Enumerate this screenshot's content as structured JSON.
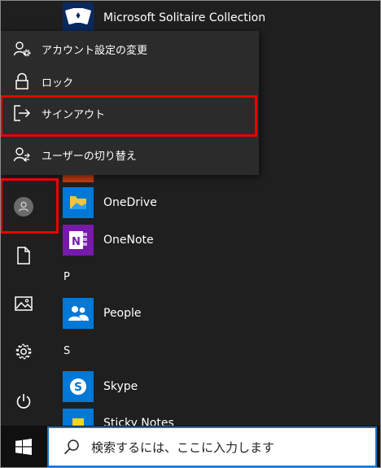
{
  "account_menu": {
    "items": [
      {
        "label": "アカウント設定の変更",
        "icon": "person-settings-icon"
      },
      {
        "label": "ロック",
        "icon": "lock-icon"
      },
      {
        "label": "サインアウト",
        "icon": "sign-out-icon"
      },
      {
        "label": "ユーザーの切り替え",
        "icon": "switch-user-icon"
      }
    ],
    "highlighted": "サインアウト"
  },
  "apps": {
    "solitaire": "Microsoft Solitaire Collection",
    "onedrive": "OneDrive",
    "onenote": "OneNote",
    "people": "People",
    "skype": "Skype",
    "sticky": "Sticky Notes"
  },
  "letters": {
    "p": "P",
    "s": "S"
  },
  "rail": [
    "user-avatar",
    "documents-icon",
    "pictures-icon",
    "settings-icon",
    "power-icon"
  ],
  "taskbar": {
    "search_placeholder": "検索するには、ここに入力します"
  },
  "colors": {
    "accent": "#0078d7",
    "highlight": "#e00000",
    "onenote": "#7719aa",
    "onedrive_bg": "#0078d7"
  }
}
